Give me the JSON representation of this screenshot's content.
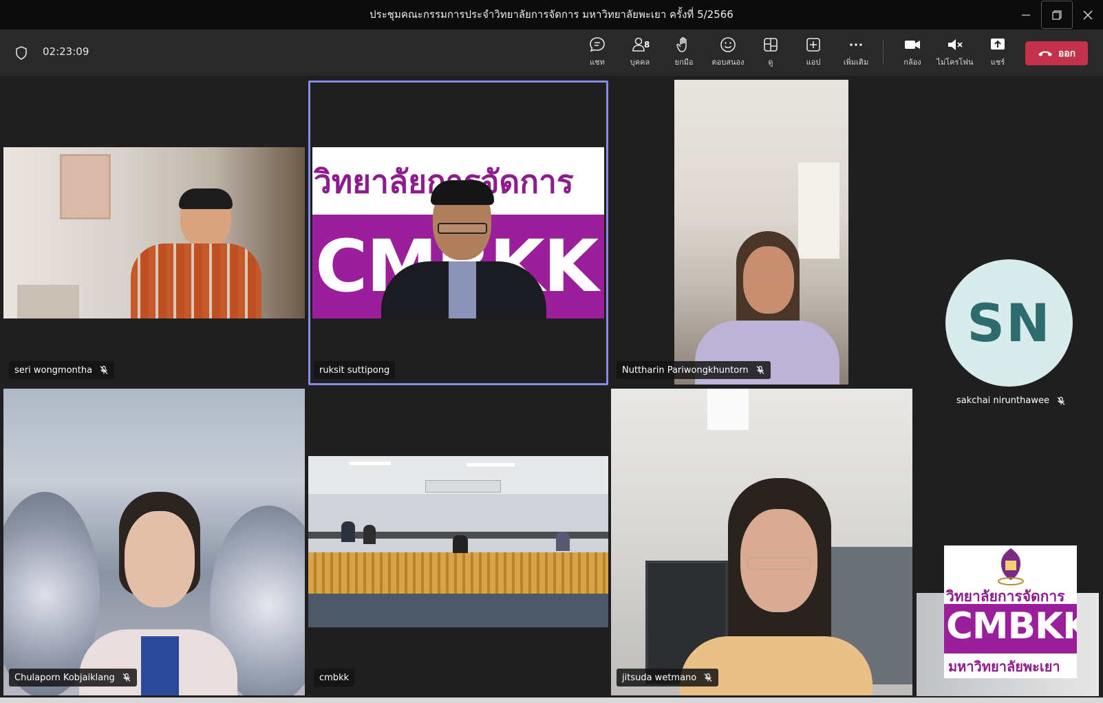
{
  "window": {
    "title": "ประชุมคณะกรรมการประจำวิทยาลัยการจัดการ มหาวิทยาลัยพะเยา ครั้งที่ 5/2566",
    "min_icon": "minimize-icon",
    "restore_icon": "restore-icon",
    "close_icon": "close-icon"
  },
  "meeting": {
    "timer": "02:23:09"
  },
  "toolbar": {
    "chat": {
      "label": "แชท",
      "icon": "chat-icon"
    },
    "people": {
      "label": "บุคคล",
      "count": "8",
      "icon": "people-icon"
    },
    "raise_hand": {
      "label": "ยกมือ",
      "icon": "hand-icon"
    },
    "react": {
      "label": "ตอบสนอง",
      "icon": "smile-icon"
    },
    "view": {
      "label": "ดู",
      "icon": "layout-icon"
    },
    "apps": {
      "label": "แอป",
      "icon": "plus-square-icon"
    },
    "more": {
      "label": "เพิ่มเติม",
      "icon": "more-icon"
    },
    "camera": {
      "label": "กล้อง",
      "icon": "camera-icon"
    },
    "mic": {
      "label": "ไม่โครโฟน",
      "icon": "mic-muted-icon"
    },
    "share": {
      "label": "แชร์",
      "icon": "share-icon"
    },
    "leave": {
      "label": "ออก",
      "icon": "phone-hangup-icon",
      "color": "#c4314b"
    }
  },
  "participants": [
    {
      "name": "seri wongmontha",
      "muted": true
    },
    {
      "name": "ruksit suttipong",
      "muted": false,
      "active": true
    },
    {
      "name": "Nuttharin Pariwongkhuntorn",
      "muted": true
    },
    {
      "name": "sakchai nirunthawee",
      "muted": true,
      "initials": "SN"
    },
    {
      "name": "Chulaporn Kobjaiklang",
      "muted": true
    },
    {
      "name": "cmbkk",
      "muted": false
    },
    {
      "name": "jitsuda wetmano",
      "muted": true
    }
  ],
  "backgrounds": {
    "banner_thai": "วิทยาลัยการจัดการ",
    "banner_brand": "CMBKK",
    "banner_university": "มหาวิทยาลัยพะเยา",
    "banner_top": "วิทยาลัยก ารจัดการ"
  },
  "colors": {
    "accent": "#8a8be8",
    "brand_purple": "#9b1f9b",
    "avatar_bg": "#d9ecec",
    "avatar_text": "#2e6b6e"
  }
}
